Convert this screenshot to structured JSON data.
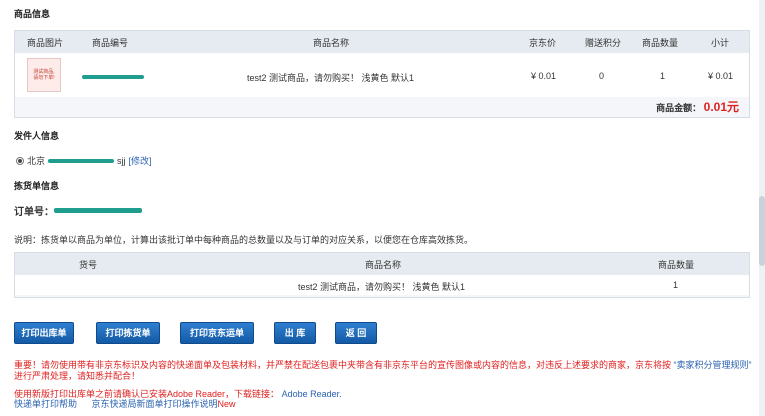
{
  "product_section": {
    "title": "商品信息",
    "headers": [
      "商品图片",
      "商品编号",
      "商品名称",
      "京东价",
      "赠送积分",
      "商品数量",
      "小计"
    ],
    "row": {
      "thumb_text_1": "测试商品,",
      "thumb_text_2": "请勿下单!",
      "name": "test2 测试商品，请勿购买！ 浅黄色 默认1",
      "price": "¥ 0.01",
      "points": "0",
      "qty": "1",
      "subtotal": "¥ 0.01"
    },
    "amount_label": "商品金额：",
    "amount_value": "0.01元"
  },
  "sender_section": {
    "title": "发件人信息",
    "sender_prefix": "北京",
    "sender_suffix": "sjj",
    "modify_link": "[修改]"
  },
  "picking_section": {
    "title": "拣货单信息",
    "order_label": "订单号："
  },
  "explain_text": "说明：拣货单以商品为单位，计算出该批订单中每种商品的总数量以及与订单的对应关系，以便您在仓库高效拣货。",
  "picking_table": {
    "headers": [
      "货号",
      "商品名称",
      "商品数量"
    ],
    "row": {
      "name": "test2 测试商品，请勿购买！ 浅黄色 默认1",
      "qty": "1"
    }
  },
  "buttons": {
    "print_outbound": "打印出库单",
    "print_picking": "打印拣货单",
    "print_jd_waybill": "打印京东运单",
    "outbound": "出 库",
    "back": "返 回"
  },
  "notice": {
    "important_text": "重要！请勿使用带有非京东标识及内容的快递面单及包装材料，并严禁在配送包裹中夹带含有非京东平台的宣传图像或内容的信息，对违反上述要求的商家，京东将按",
    "rule_link": "“卖家积分管理规则”",
    "important_tail": "进行严肃处理，请知悉并配合！",
    "reader_prefix": "使用新版打印出库单之前请确认已安装Adobe Reader，下载链接：",
    "reader_link": "Adobe Reader.",
    "help_link": "快递单打印帮助",
    "new_help_link": "京东快递局新面单打印操作说明",
    "new_badge": "New"
  },
  "colors": {
    "button_blue": "#1b66b8",
    "accent_red": "#e02020",
    "link_blue": "#2a62b0",
    "panel_bg": "#f4f6f9",
    "header_bg": "#e6ebf1"
  }
}
